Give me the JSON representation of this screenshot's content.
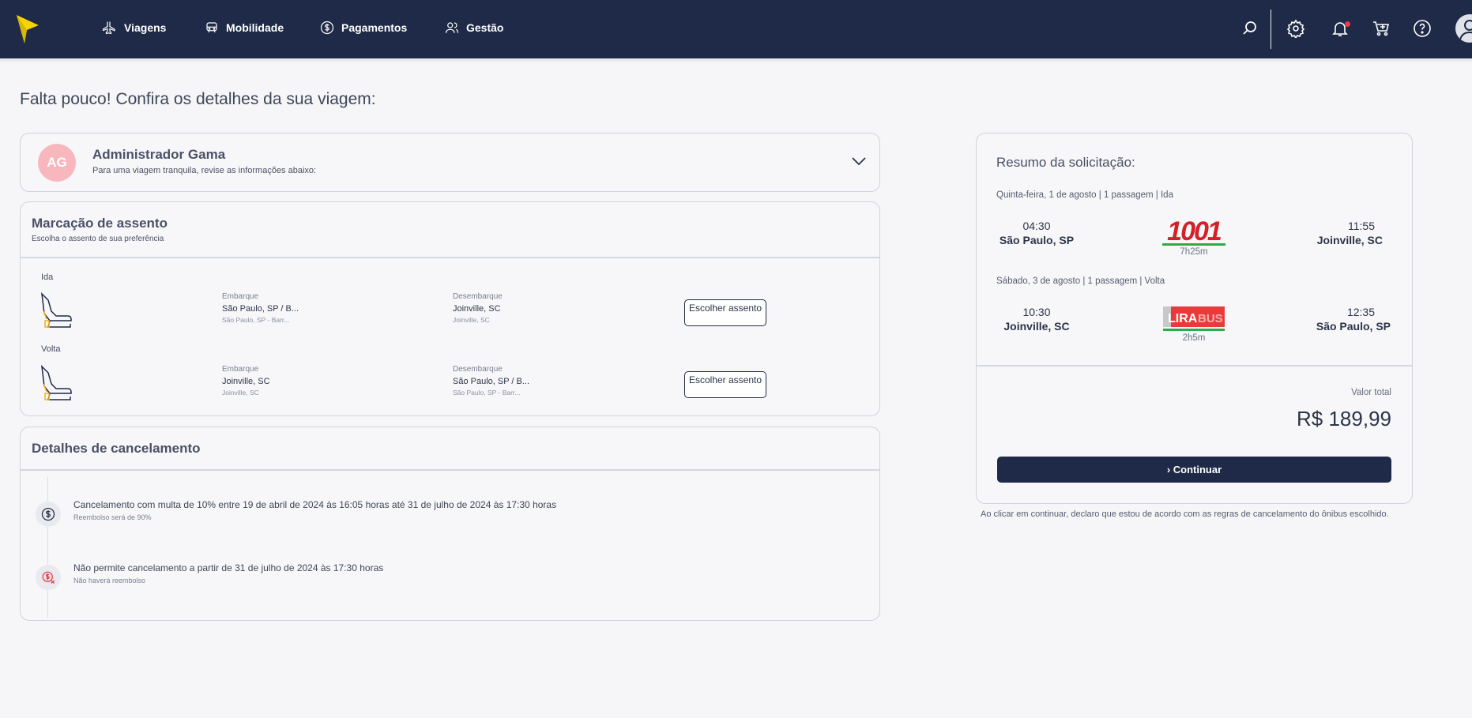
{
  "nav": {
    "items": [
      {
        "label": "Viagens",
        "icon": "plane-icon"
      },
      {
        "label": "Mobilidade",
        "icon": "car-icon"
      },
      {
        "label": "Pagamentos",
        "icon": "dollar-icon"
      },
      {
        "label": "Gestão",
        "icon": "users-icon"
      }
    ],
    "right_icons": [
      "search-icon",
      "gear-icon",
      "bell-icon",
      "cart-icon",
      "help-icon",
      "user-avatar-icon"
    ],
    "colors": {
      "bar": "#1e2a47",
      "logo": "#f5d400",
      "notification": "#f0394b"
    }
  },
  "page": {
    "title": "Falta pouco! Confira os detalhes da sua viagem:"
  },
  "traveler": {
    "initials": "AG",
    "name": "Administrador Gama",
    "subtitle": "Para uma viagem tranquila, revise as informações abaixo:"
  },
  "seats": {
    "title": "Marcação de assento",
    "subtitle": "Escolha o assento de sua preferência",
    "legs": [
      {
        "label": "Ida",
        "embark_label": "Embarque",
        "embark_place": "São Paulo, SP / B...",
        "embark_detail": "São Paulo, SP - Barr...",
        "disembark_label": "Desembarque",
        "disembark_place": "Joinville, SC",
        "disembark_detail": "Joinville, SC",
        "button": "Escolher assento"
      },
      {
        "label": "Volta",
        "embark_label": "Embarque",
        "embark_place": "Joinville, SC",
        "embark_detail": "Joinville, SC",
        "disembark_label": "Desembarque",
        "disembark_place": "São Paulo, SP / B...",
        "disembark_detail": "São Paulo, SP - Barr...",
        "button": "Escolher assento"
      }
    ]
  },
  "cancellation": {
    "title": "Detalhes de cancelamento",
    "items": [
      {
        "text": "Cancelamento com multa de 10% entre 19 de abril de 2024 às 16:05 horas até 31 de julho de 2024 às 17:30 horas",
        "sub": "Reembolso será de 90%",
        "icon": "dollar-icon"
      },
      {
        "text": "Não permite cancelamento a partir de 31 de julho de 2024 às 17:30 horas",
        "sub": "Não haverá reembolso",
        "icon": "no-refund-icon"
      }
    ]
  },
  "summary": {
    "title": "Resumo da solicitação:",
    "trips": [
      {
        "meta": "Quinta-feira, 1 de agosto | 1 passagem | Ida",
        "depart_time": "04:30",
        "depart_city": "São Paulo, SP",
        "carrier_logo": "1001",
        "duration": "7h25m",
        "arrive_time": "11:55",
        "arrive_city": "Joinville, SC"
      },
      {
        "meta": "Sábado, 3 de agosto | 1 passagem | Volta",
        "depart_time": "10:30",
        "depart_city": "Joinville, SC",
        "carrier_logo_a": "LIRA",
        "carrier_logo_b": "BUS",
        "duration": "2h5m",
        "arrive_time": "12:35",
        "arrive_city": "São Paulo, SP"
      }
    ],
    "total_label": "Valor total",
    "total_value": "R$ 189,99",
    "continue_label": "› Continuar",
    "disclaimer": "Ao clicar em continuar, declaro que estou de acordo com as regras de cancelamento do ônibus escolhido."
  }
}
